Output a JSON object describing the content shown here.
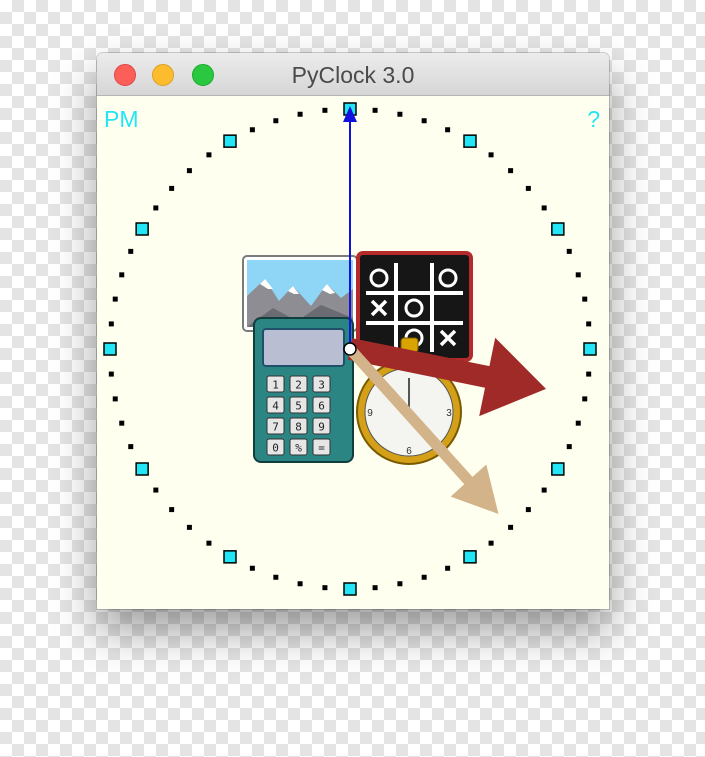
{
  "window": {
    "title": "PyClock 3.0",
    "buttons": [
      "close",
      "minimize",
      "zoom"
    ]
  },
  "clock": {
    "ampm": "PM",
    "help": "?",
    "time": {
      "hour": 3,
      "minute": 23,
      "second": 0
    },
    "face_background": "#fffff0",
    "marker_color": "#22e5f5",
    "hour_hand_color": "#a02a28",
    "minute_hand_color": "#d3b48a",
    "second_hand_color": "#1111dd",
    "center_image_icons": [
      "landscape-photo-icon",
      "calculator-icon",
      "tic-tac-toe-icon",
      "stopwatch-icon"
    ],
    "calculator_keys": [
      "1",
      "2",
      "3",
      "4",
      "5",
      "6",
      "7",
      "8",
      "9",
      "0",
      "%",
      "="
    ],
    "ttt_board": [
      "O",
      "",
      "O",
      "X",
      "O",
      "",
      "",
      "O",
      "X"
    ]
  }
}
